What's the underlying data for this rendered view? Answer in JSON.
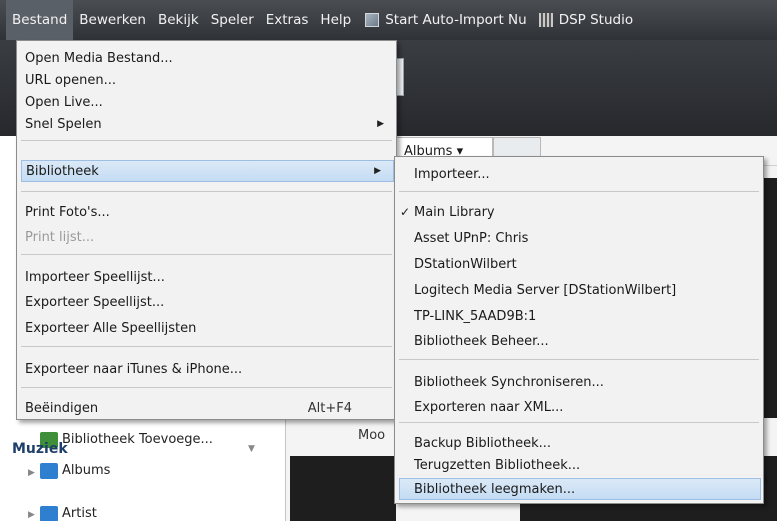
{
  "menubar": {
    "items": [
      "Bestand",
      "Bewerken",
      "Bekijk",
      "Speler",
      "Extras",
      "Help"
    ],
    "start_auto_import": "Start Auto-Import Nu",
    "dsp_studio": "DSP Studio",
    "icons": {
      "auto_import": "image-icon",
      "dsp": "equalizer-icon"
    }
  },
  "file_menu": {
    "items": [
      "Open Media Bestand...",
      "URL openen...",
      "Open Live...",
      "Snel Spelen",
      "Bibliotheek",
      "Print Foto's...",
      "Print lijst...",
      "Importeer Speellijst...",
      "Exporteer Speellijst...",
      "Exporteer Alle Speellijsten",
      "Exporteer naar iTunes & iPhone...",
      "Beëindigen"
    ],
    "exit_shortcut": "Alt+F4"
  },
  "library_menu": {
    "items": [
      "Importeer...",
      "Main Library",
      "Asset UPnP: Chris",
      "DStationWilbert",
      "Logitech Media Server [DStationWilbert]",
      "TP-LINK_5AAD9B:1",
      "Bibliotheek Beheer...",
      "Bibliotheek Synchroniseren...",
      "Exporteren naar XML...",
      "Backup Bibliotheek...",
      "Terugzetten Bibliotheek...",
      "Bibliotheek leegmaken..."
    ],
    "checkmark": "✓"
  },
  "background": {
    "albums_tab": "Albums ▾",
    "album_caption": "Moo",
    "sidebar": {
      "add_library": "Bibliotheek Toevoege...",
      "music_header": "Muziek",
      "albums": "Albums",
      "artist": "Artist"
    }
  }
}
